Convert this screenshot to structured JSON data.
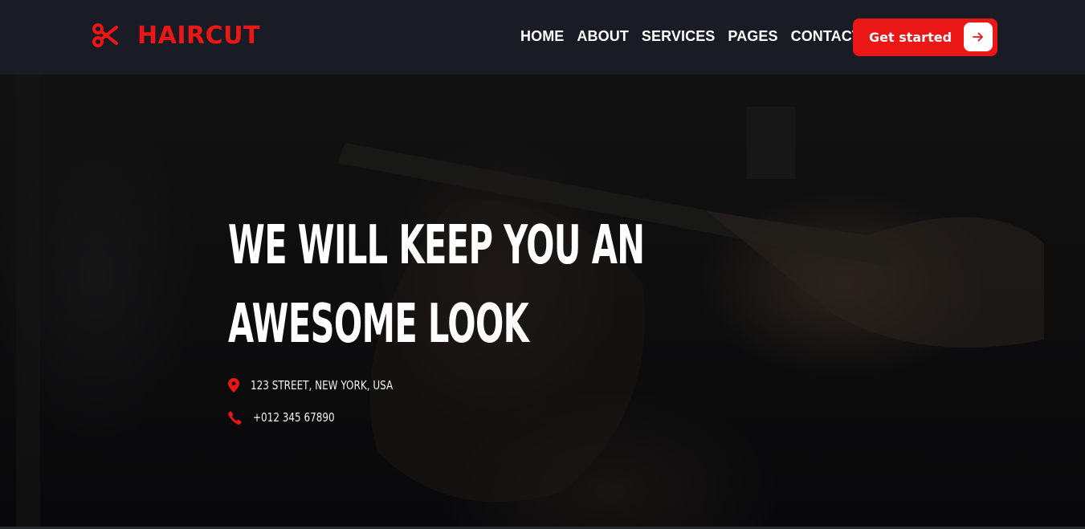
{
  "brand": {
    "name": "HAIRCUT",
    "icon": "scissors-icon",
    "color": "#eb1616"
  },
  "nav": {
    "items": [
      {
        "label": "HOME"
      },
      {
        "label": "ABOUT"
      },
      {
        "label": "SERVICES"
      },
      {
        "label": "PAGES"
      },
      {
        "label": "CONTACT"
      }
    ],
    "cta": {
      "label": "Get started",
      "icon": "arrow-right-icon"
    }
  },
  "hero": {
    "headline": [
      "WE WILL KEEP YOU AN",
      "AWESOME LOOK"
    ],
    "address": {
      "icon": "map-marker-icon",
      "text": "123 STREET, NEW YORK, USA"
    },
    "phone": {
      "icon": "phone-icon",
      "text": "+012 345 67890"
    }
  },
  "colors": {
    "accent": "#eb1616",
    "navbar": "#191c24",
    "text": "#ffffff"
  }
}
